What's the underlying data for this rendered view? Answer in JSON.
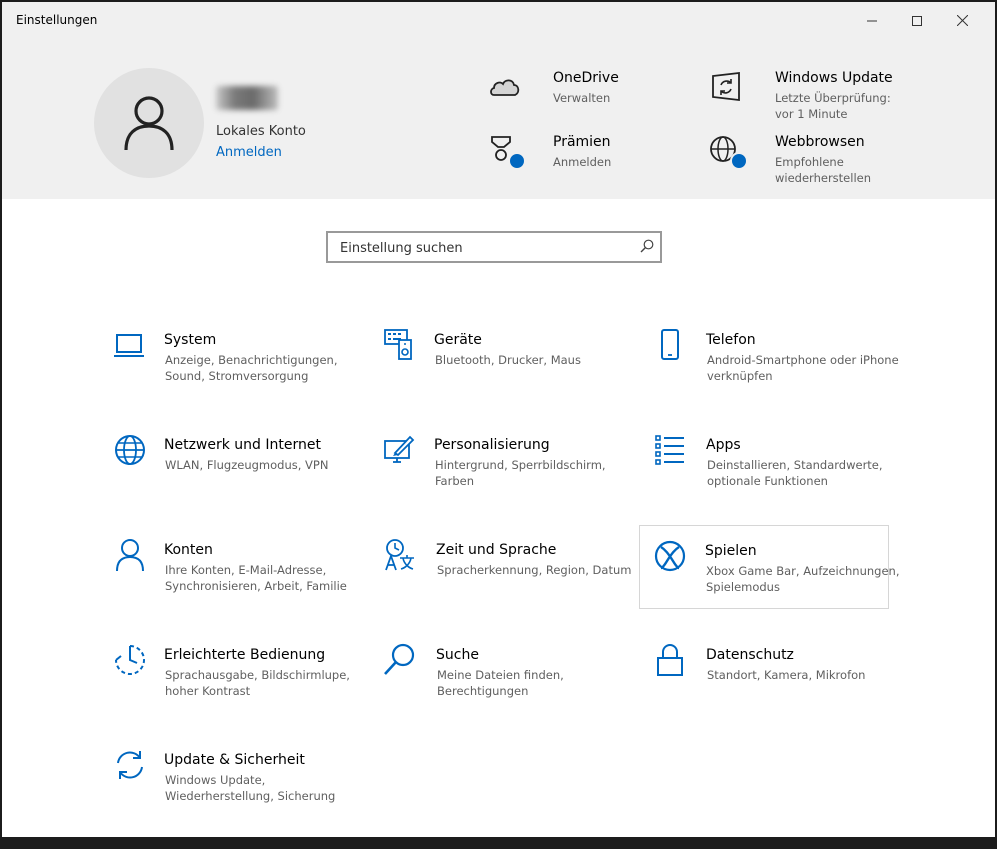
{
  "window": {
    "title": "Einstellungen",
    "controls": {
      "minimize": "minimize",
      "maximize": "maximize",
      "close": "close"
    }
  },
  "account": {
    "type": "Lokales Konto",
    "signin_label": "Anmelden"
  },
  "quick_links": [
    {
      "title": "OneDrive",
      "subtitle": "Verwalten",
      "icon": "cloud-icon"
    },
    {
      "title": "Windows Update",
      "subtitle": "Letzte Überprüfung: vor 1 Minute",
      "icon": "windows-update-icon"
    },
    {
      "title": "Prämien",
      "subtitle": "Anmelden",
      "icon": "rewards-icon"
    },
    {
      "title": "Webbrowsen",
      "subtitle": "Empfohlene wiederherstellen",
      "icon": "globe-icon"
    }
  ],
  "search": {
    "placeholder": "Einstellung suchen"
  },
  "categories": [
    {
      "title": "System",
      "subtitle": "Anzeige, Benachrichtigungen, Sound, Stromversorgung"
    },
    {
      "title": "Geräte",
      "subtitle": "Bluetooth, Drucker, Maus"
    },
    {
      "title": "Telefon",
      "subtitle": "Android-Smartphone oder iPhone verknüpfen"
    },
    {
      "title": "Netzwerk und Internet",
      "subtitle": "WLAN, Flugzeugmodus, VPN"
    },
    {
      "title": "Personalisierung",
      "subtitle": "Hintergrund, Sperrbildschirm, Farben"
    },
    {
      "title": "Apps",
      "subtitle": "Deinstallieren, Standardwerte, optionale Funktionen"
    },
    {
      "title": "Konten",
      "subtitle": "Ihre Konten, E-Mail-Adresse, Synchronisieren, Arbeit, Familie"
    },
    {
      "title": "Zeit und Sprache",
      "subtitle": "Spracherkennung, Region, Datum"
    },
    {
      "title": "Spielen",
      "subtitle": "Xbox Game Bar, Aufzeichnungen, Spielemodus"
    },
    {
      "title": "Erleichterte Bedienung",
      "subtitle": "Sprachausgabe, Bildschirmlupe, hoher Kontrast"
    },
    {
      "title": "Suche",
      "subtitle": "Meine Dateien finden, Berechtigungen"
    },
    {
      "title": "Datenschutz",
      "subtitle": "Standort, Kamera, Mikrofon"
    },
    {
      "title": "Update & Sicherheit",
      "subtitle": "Windows Update, Wiederherstellung, Sicherung"
    }
  ],
  "colors": {
    "accent": "#0067c0",
    "hero_bg": "#f0f0f0"
  }
}
